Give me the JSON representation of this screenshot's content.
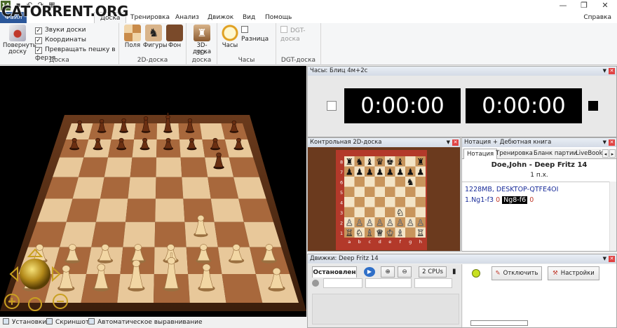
{
  "watermark": "CATORRENT.ORG",
  "titlebar": {
    "logo": "14",
    "window_buttons": [
      "—",
      "❐",
      "✕"
    ]
  },
  "ribbon_tabs": {
    "file": "Файл",
    "active": "Доска",
    "items": [
      "Доска",
      "Тренировка",
      "Анализ",
      "Движок",
      "Вид",
      "Помощь"
    ],
    "help": "Справка"
  },
  "ribbon": {
    "rotate_label_1": "Повернуть",
    "rotate_label_2": "доску",
    "checks": [
      {
        "label": "Звуки доски",
        "checked": true
      },
      {
        "label": "Координаты",
        "checked": true
      },
      {
        "label": "Превращать пешку в ферзя",
        "checked": true
      }
    ],
    "group_board": "Доска",
    "btn_field": "Поля",
    "btn_pieces": "Фигуры",
    "btn_background": "Фон",
    "group_2d": "2D-доска",
    "btn_3d": "3D-доска",
    "group_3d": "3D-доска",
    "btn_clock": "Часы",
    "chk_difference": "Разница",
    "group_clock": "Часы",
    "chk_dgt": "DGT-доска",
    "group_dgt": "DGT-доска"
  },
  "status": {
    "settings": "Установки",
    "screenshot": "Скриншот",
    "auto_align": "Автоматическое выравнивание"
  },
  "clock_panel": {
    "title": "Часы: Блиц 4м+2с",
    "white_time": "0:00:00",
    "black_time": "0:00:00"
  },
  "board2d_panel": {
    "title": "Контрольная 2D-доска",
    "files": [
      "a",
      "b",
      "c",
      "d",
      "e",
      "f",
      "g",
      "h"
    ],
    "ranks": [
      "8",
      "7",
      "6",
      "5",
      "4",
      "3",
      "2",
      "1"
    ]
  },
  "notation_panel": {
    "title": "Нотация + Дебютная книга",
    "tabs": [
      "Нотация",
      "Тренировка",
      "Бланк партии",
      "LiveBook"
    ],
    "game_title": "Doe,John - Deep Fritz 14",
    "game_sub": "1 п.х.",
    "engine_info": "1228MB, DESKTOP-QTFE4OI",
    "move_white": "1.Ng1-f3",
    "eval_1": "0",
    "move_black": "Ng8-f6",
    "eval_2": "0"
  },
  "engine_panel": {
    "title": "Движки: Deep Fritz 14",
    "status_tab": "Остановлен",
    "cpus": "2 CPUs",
    "btn_disconnect": "Отключить",
    "btn_settings": "Настройки"
  },
  "colors": {
    "accent": "#2b579a",
    "board_light": "#e8c89a",
    "board_dark": "#a8683c",
    "clock_bg": "#000000"
  }
}
